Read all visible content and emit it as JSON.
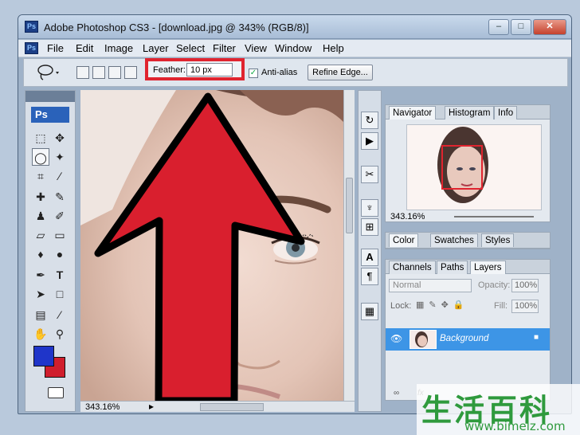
{
  "window": {
    "title": "Adobe Photoshop CS3 - [download.jpg @ 343% (RGB/8)]",
    "app_icon_label": "Ps",
    "min_label": "–",
    "max_label": "□",
    "close_label": "✕"
  },
  "menu": [
    "File",
    "Edit",
    "Image",
    "Layer",
    "Select",
    "Filter",
    "View",
    "Window",
    "Help"
  ],
  "options": {
    "feather_label": "Feather:",
    "feather_value": "10 px",
    "antialias_label": "Anti-alias",
    "antialias_checked": "✓",
    "refine_edge_label": "Refine Edge..."
  },
  "toolbox": {
    "logo": "Ps",
    "fg_color": "#1f35c9",
    "bg_color": "#d01e2d"
  },
  "canvas": {
    "zoom_status": "343.16%",
    "arrow_color": "#d91f2e"
  },
  "navigator": {
    "tabs": [
      "Navigator",
      "Histogram",
      "Info"
    ],
    "zoom": "343.16%"
  },
  "color_panel": {
    "tabs": [
      "Color",
      "Swatches",
      "Styles"
    ]
  },
  "layers_panel": {
    "tabs": [
      "Channels",
      "Paths",
      "Layers"
    ],
    "blend_mode": "Normal",
    "opacity_label": "Opacity:",
    "opacity_value": "100%",
    "lock_label": "Lock:",
    "fill_label": "Fill:",
    "fill_value": "100%",
    "layer_name": "Background"
  },
  "watermark": {
    "chars": "生活百科",
    "url": "www.bimeiz.com"
  }
}
